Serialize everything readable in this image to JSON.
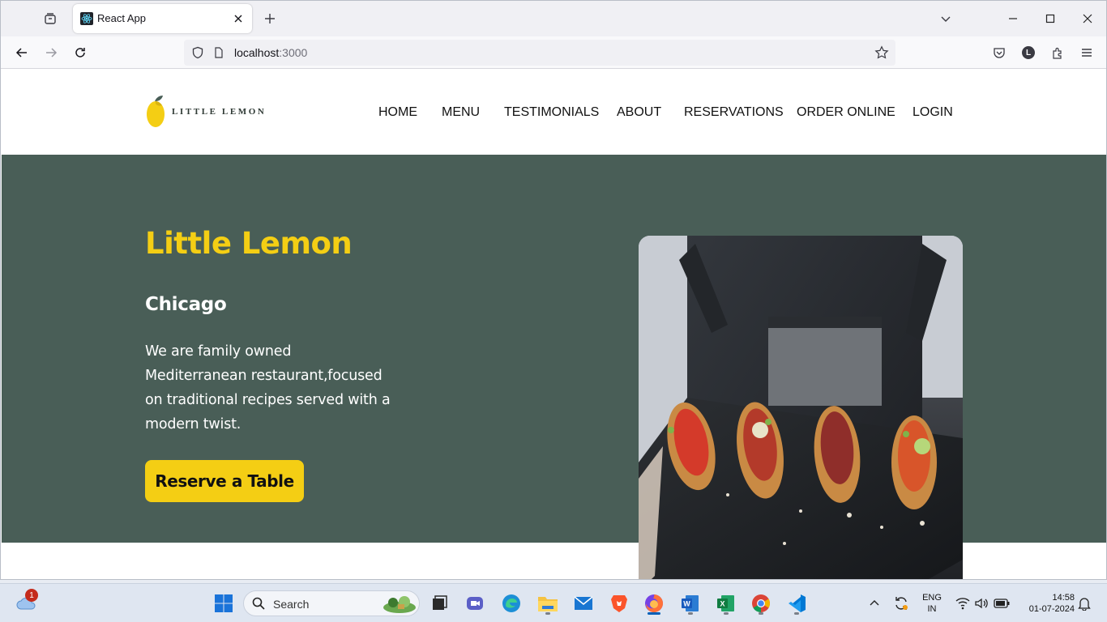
{
  "browser": {
    "tab": {
      "title": "React App",
      "favicon": "react-logo-icon"
    },
    "url": {
      "host": "localhost",
      "port": ":3000"
    },
    "icons": [
      "tab-list-icon",
      "close-icon",
      "plus-icon",
      "chevron-down-icon",
      "minimize-icon",
      "maximize-icon",
      "back-icon",
      "forward-icon",
      "reload-icon",
      "shield-icon",
      "page-icon",
      "star-icon",
      "pocket-icon",
      "account-icon",
      "extensions-icon",
      "menu-icon"
    ],
    "account_initial": "L"
  },
  "site": {
    "logo_text": "LITTLE LEMON",
    "nav": [
      "HOME",
      "MENU",
      "TESTIMONIALS",
      "ABOUT",
      "RESERVATIONS",
      "ORDER ONLINE",
      "LOGIN"
    ],
    "hero": {
      "title": "Little Lemon",
      "city": "Chicago",
      "description": "We are family owned Mediterranean restaurant,focused on traditional recipes served with a modern twist.",
      "button": "Reserve a Table",
      "image": "food-platter-photo"
    },
    "colors": {
      "primary_green": "#495e57",
      "primary_yellow": "#f4ce14"
    }
  },
  "taskbar": {
    "weather_badge": "1",
    "search_placeholder": "Search",
    "apps": [
      "start-icon",
      "search-icon",
      "task-view-icon",
      "meet-icon",
      "edge-icon",
      "file-explorer-icon",
      "mail-icon",
      "brave-icon",
      "firefox-icon",
      "word-icon",
      "excel-icon",
      "chrome-icon",
      "vscode-icon"
    ],
    "lang_line1": "ENG",
    "lang_line2": "IN",
    "time": "14:58",
    "date": "01-07-2024"
  }
}
